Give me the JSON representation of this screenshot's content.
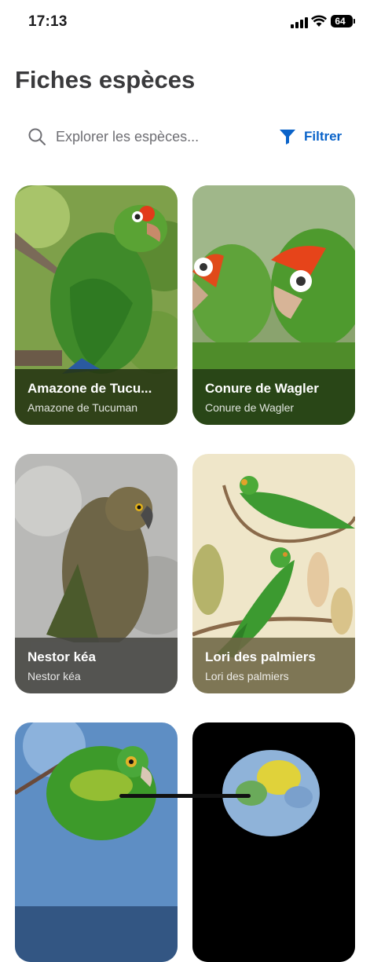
{
  "status_bar": {
    "time": "17:13",
    "battery": "64",
    "icons": [
      "cellular-signal-icon",
      "wifi-icon",
      "battery-icon"
    ]
  },
  "header": {
    "title": "Fiches espèces"
  },
  "search": {
    "placeholder": "Explorer les espèces...",
    "value": "",
    "filter_label": "Filtrer",
    "accent_color": "#0a63c9"
  },
  "species": [
    {
      "name": "Amazone de Tucu...",
      "subname": "Amazone de Tucuman",
      "caption_color": "#3b4a24"
    },
    {
      "name": "Conure de Wagler",
      "subname": "Conure de Wagler",
      "caption_color": "#36481f"
    },
    {
      "name": "Nestor kéa",
      "subname": "Nestor kéa",
      "caption_color": "#4a4a46"
    },
    {
      "name": "Lori des palmiers",
      "subname": "Lori des palmiers",
      "caption_color": "#6b6443"
    },
    {
      "name": "",
      "subname": "",
      "caption_color": "#2d4f7a"
    },
    {
      "name": "",
      "subname": "",
      "caption_color": "#000000"
    }
  ]
}
